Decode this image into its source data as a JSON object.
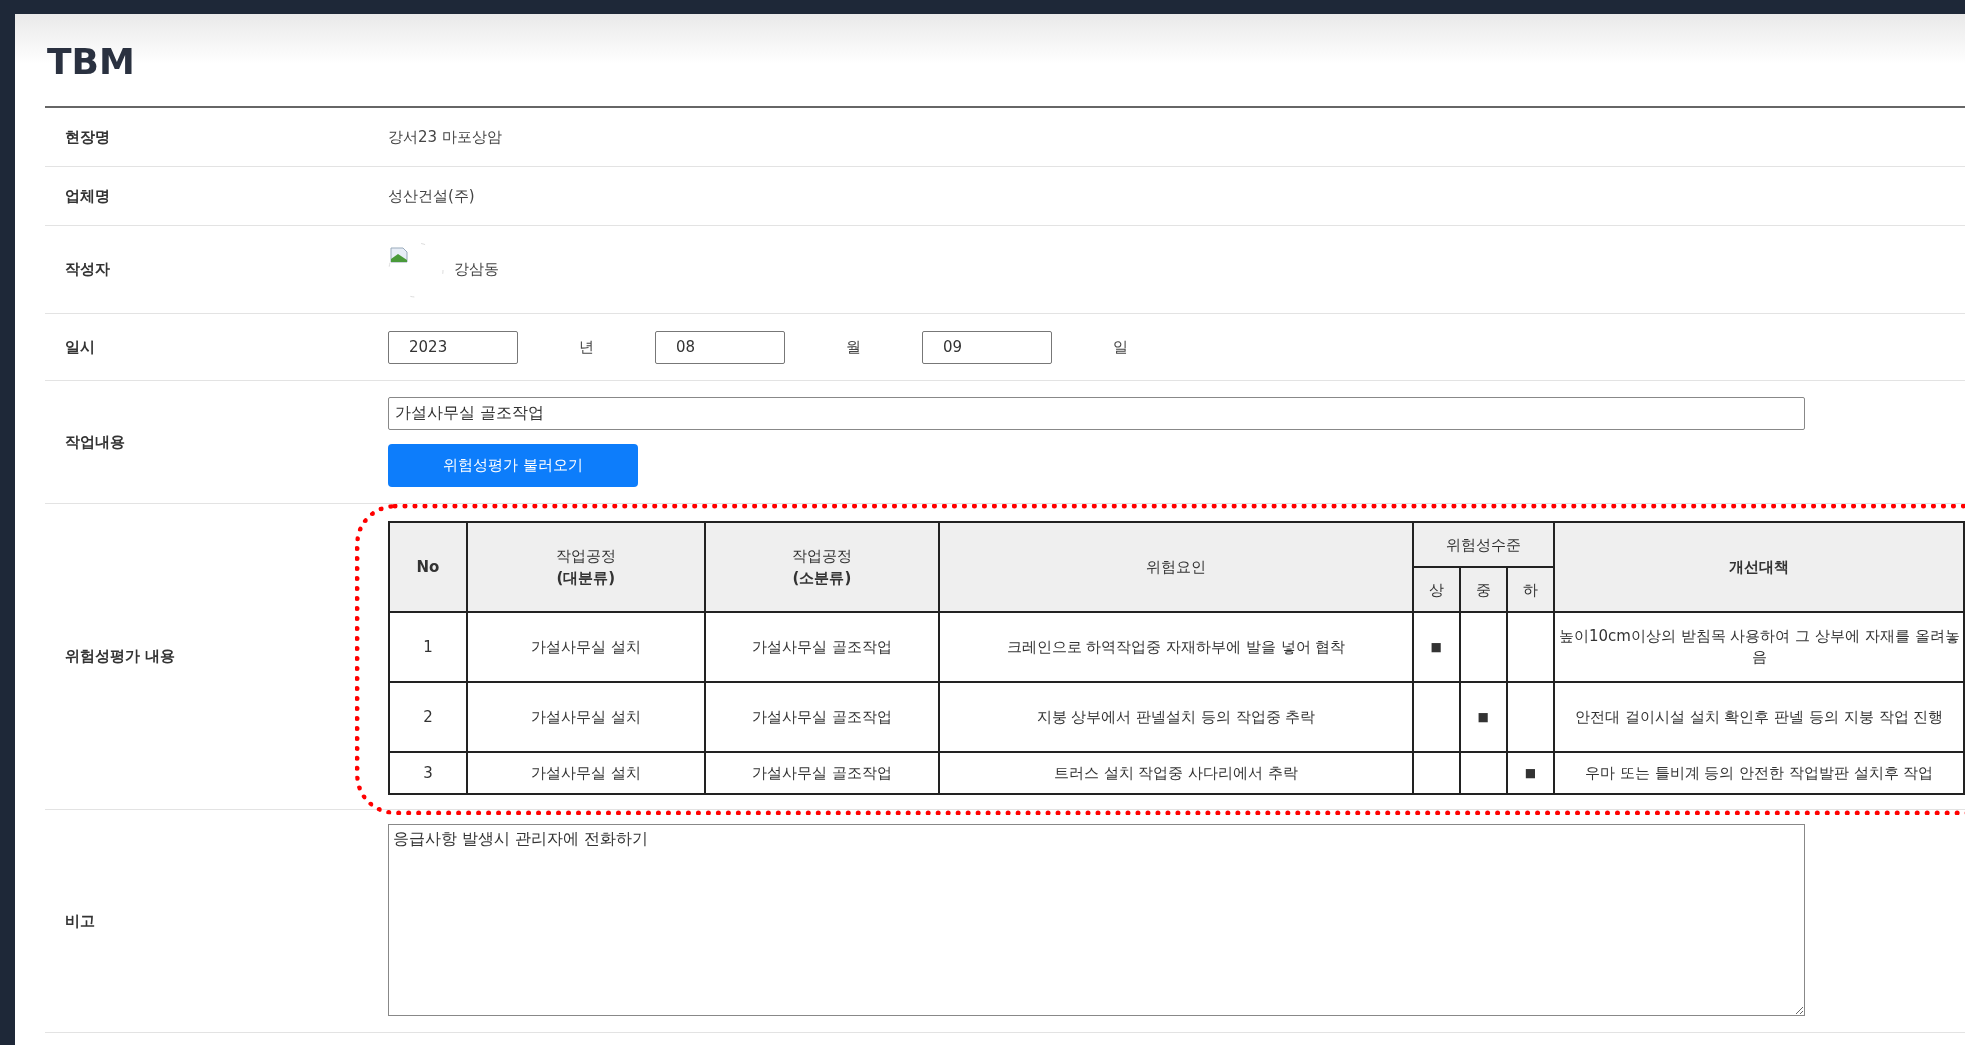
{
  "title": "TBM",
  "site": {
    "label": "현장명",
    "value": "강서23 마포상암"
  },
  "company": {
    "label": "업체명",
    "value": "성산건설(주)"
  },
  "author": {
    "label": "작성자",
    "name": "강삼동"
  },
  "date": {
    "label": "일시",
    "year": "2023",
    "year_unit": "년",
    "month": "08",
    "month_unit": "월",
    "day": "09",
    "day_unit": "일"
  },
  "work": {
    "label": "작업내용",
    "value": "가설사무실 골조작업",
    "button": "위험성평가 불러오기"
  },
  "risk": {
    "label": "위험성평가 내용",
    "headers": {
      "no": "No",
      "major": [
        "작업공정",
        "(대분류)"
      ],
      "minor": [
        "작업공정",
        "(소분류)"
      ],
      "hazard": "위험요인",
      "level_group": "위험성수준",
      "levels": [
        "상",
        "중",
        "하"
      ],
      "measure": "개선대책"
    },
    "mark": "■",
    "rows": [
      {
        "no": "1",
        "major": "가설사무실 설치",
        "minor": "가설사무실 골조작업",
        "hazard": "크레인으로 하역작업중 자재하부에 발을 넣어 협착",
        "levels": [
          true,
          false,
          false
        ],
        "measure": "높이10cm이상의 받침목 사용하여 그 상부에 자재를 올려놓음"
      },
      {
        "no": "2",
        "major": "가설사무실 설치",
        "minor": "가설사무실 골조작업",
        "hazard": "지붕 상부에서 판넬설치 등의 작업중 추락",
        "levels": [
          false,
          true,
          false
        ],
        "measure": "안전대 걸이시설 설치 확인후 판넬 등의 지붕 작업 진행"
      },
      {
        "no": "3",
        "major": "가설사무실 설치",
        "minor": "가설사무실 골조작업",
        "hazard": "트러스 설치 작업중 사다리에서 추락",
        "levels": [
          false,
          false,
          true
        ],
        "measure": "우마 또는 틀비계 등의 안전한 작업발판 설치후 작업"
      }
    ]
  },
  "remarks": {
    "label": "비고",
    "value": "응급사항 발생시 관리자에 전화하기"
  }
}
